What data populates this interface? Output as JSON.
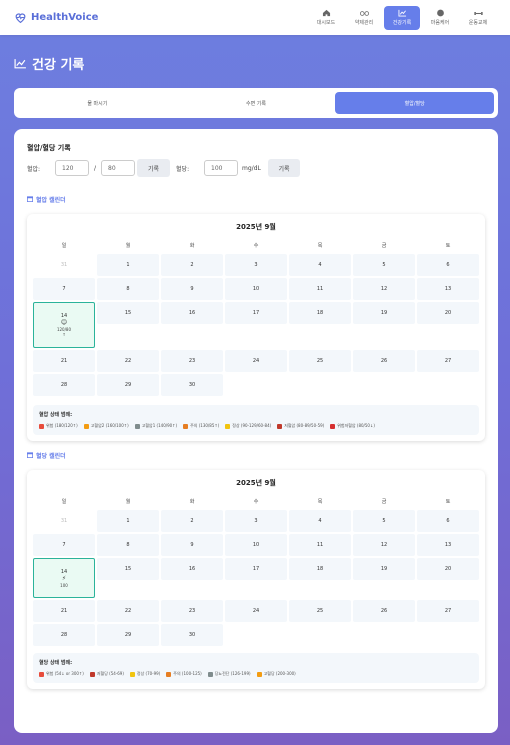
{
  "app": {
    "name": "HealthVoice"
  },
  "nav": [
    {
      "label": "대시보드",
      "icon": "home-icon",
      "active": false
    },
    {
      "label": "약제관리",
      "icon": "pills-icon",
      "active": false
    },
    {
      "label": "건강기록",
      "icon": "chart-icon",
      "active": true
    },
    {
      "label": "마음케어",
      "icon": "brain-icon",
      "active": false
    },
    {
      "label": "운동교체",
      "icon": "dumbbell-icon",
      "active": false
    }
  ],
  "page": {
    "title": "건강 기록"
  },
  "tabs": [
    {
      "label": "물 마시기",
      "active": false
    },
    {
      "label": "수면 기록",
      "active": false
    },
    {
      "label": "혈압/혈당",
      "active": true
    }
  ],
  "record": {
    "title": "혈압/혈당 기록",
    "bp_label": "혈압:",
    "sys_placeholder": "120",
    "slash": "/",
    "dia_placeholder": "80",
    "bp_button": "기록",
    "sugar_label": "혈당:",
    "sugar_placeholder": "100",
    "sugar_unit": "mg/dL",
    "sugar_button": "기록"
  },
  "calendars": [
    {
      "section_label": "혈압 캘린더",
      "month_title": "2025년 9월",
      "weekdays": [
        "일",
        "월",
        "화",
        "수",
        "목",
        "금",
        "토"
      ],
      "days": [
        {
          "d": "31",
          "other": true
        },
        {
          "d": "1"
        },
        {
          "d": "2"
        },
        {
          "d": "3"
        },
        {
          "d": "4"
        },
        {
          "d": "5"
        },
        {
          "d": "6"
        },
        {
          "d": "7"
        },
        {
          "d": "8"
        },
        {
          "d": "9"
        },
        {
          "d": "10"
        },
        {
          "d": "11"
        },
        {
          "d": "12"
        },
        {
          "d": "13"
        },
        {
          "d": "14",
          "today": true,
          "emoji": "😊",
          "value": "120/80",
          "extra": "↑"
        },
        {
          "d": "15"
        },
        {
          "d": "16"
        },
        {
          "d": "17"
        },
        {
          "d": "18"
        },
        {
          "d": "19"
        },
        {
          "d": "20"
        },
        {
          "d": "21"
        },
        {
          "d": "22"
        },
        {
          "d": "23"
        },
        {
          "d": "24"
        },
        {
          "d": "25"
        },
        {
          "d": "26"
        },
        {
          "d": "27"
        },
        {
          "d": "28"
        },
        {
          "d": "29"
        },
        {
          "d": "30"
        }
      ],
      "legend_title": "혈압 상태 범례:",
      "legend": [
        {
          "label": "위험 (180/120↑)",
          "color": "#e74c3c"
        },
        {
          "label": "고혈압2 (160/100↑)",
          "color": "#f39c12"
        },
        {
          "label": "고혈압1 (140/90↑)",
          "color": "#7f8c8d"
        },
        {
          "label": "주의 (130/85↑)",
          "color": "#e67e22"
        },
        {
          "label": "정상 (90-129/60-84)",
          "color": "#f1c40f"
        },
        {
          "label": "저혈압 (80-89/50-59)",
          "color": "#c0392b"
        },
        {
          "label": "위험저혈압 (80/50↓)",
          "color": "#d63031"
        }
      ]
    },
    {
      "section_label": "혈당 캘린더",
      "month_title": "2025년 9월",
      "weekdays": [
        "일",
        "월",
        "화",
        "수",
        "목",
        "금",
        "토"
      ],
      "days": [
        {
          "d": "31",
          "other": true
        },
        {
          "d": "1"
        },
        {
          "d": "2"
        },
        {
          "d": "3"
        },
        {
          "d": "4"
        },
        {
          "d": "5"
        },
        {
          "d": "6"
        },
        {
          "d": "7"
        },
        {
          "d": "8"
        },
        {
          "d": "9"
        },
        {
          "d": "10"
        },
        {
          "d": "11"
        },
        {
          "d": "12"
        },
        {
          "d": "13"
        },
        {
          "d": "14",
          "today": true,
          "emoji": "⚡",
          "value": "100"
        },
        {
          "d": "15"
        },
        {
          "d": "16"
        },
        {
          "d": "17"
        },
        {
          "d": "18"
        },
        {
          "d": "19"
        },
        {
          "d": "20"
        },
        {
          "d": "21"
        },
        {
          "d": "22"
        },
        {
          "d": "23"
        },
        {
          "d": "24"
        },
        {
          "d": "25"
        },
        {
          "d": "26"
        },
        {
          "d": "27"
        },
        {
          "d": "28"
        },
        {
          "d": "29"
        },
        {
          "d": "30"
        }
      ],
      "legend_title": "혈당 상태 범례:",
      "legend": [
        {
          "label": "위험 (54↓ or 300↑)",
          "color": "#e74c3c"
        },
        {
          "label": "저혈당 (54-69)",
          "color": "#c0392b"
        },
        {
          "label": "정상 (70-99)",
          "color": "#f1c40f"
        },
        {
          "label": "주의 (100-125)",
          "color": "#e67e22"
        },
        {
          "label": "당뇨전단 (126-199)",
          "color": "#7f8c8d"
        },
        {
          "label": "고혈당 (200-300)",
          "color": "#f39c12"
        }
      ]
    }
  ],
  "colors": {
    "accent": "#667eea",
    "today_border": "#2bb39a"
  }
}
